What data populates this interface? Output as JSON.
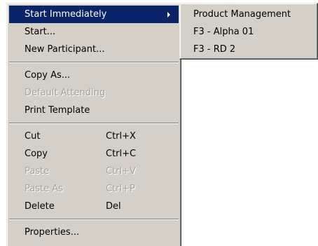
{
  "context_menu": {
    "groups": [
      {
        "items": [
          {
            "label": "Start Immediately",
            "highlighted": true,
            "has_submenu": true
          },
          {
            "label": "Start..."
          },
          {
            "label": "New Participant..."
          }
        ]
      },
      {
        "items": [
          {
            "label": "Copy As..."
          },
          {
            "label": "Default Attending",
            "disabled": true
          },
          {
            "label": "Print Template"
          }
        ]
      },
      {
        "items": [
          {
            "label": "Cut",
            "shortcut": "Ctrl+X"
          },
          {
            "label": "Copy",
            "shortcut": "Ctrl+C"
          },
          {
            "label": "Paste",
            "shortcut": "Ctrl+V",
            "disabled": true
          },
          {
            "label": "Paste As",
            "shortcut": "Ctrl+P",
            "disabled": true
          },
          {
            "label": "Delete",
            "shortcut": "Del"
          }
        ]
      },
      {
        "items": [
          {
            "label": "Properties..."
          }
        ]
      }
    ]
  },
  "submenu": {
    "items": [
      {
        "label": "Product Management"
      },
      {
        "label": "F3 - Alpha 01"
      },
      {
        "label": "F3 - RD 2"
      }
    ]
  },
  "colors": {
    "menu_background": "#d4d0c8",
    "highlight": "#0a246a",
    "disabled_text": "#a7a39a"
  }
}
